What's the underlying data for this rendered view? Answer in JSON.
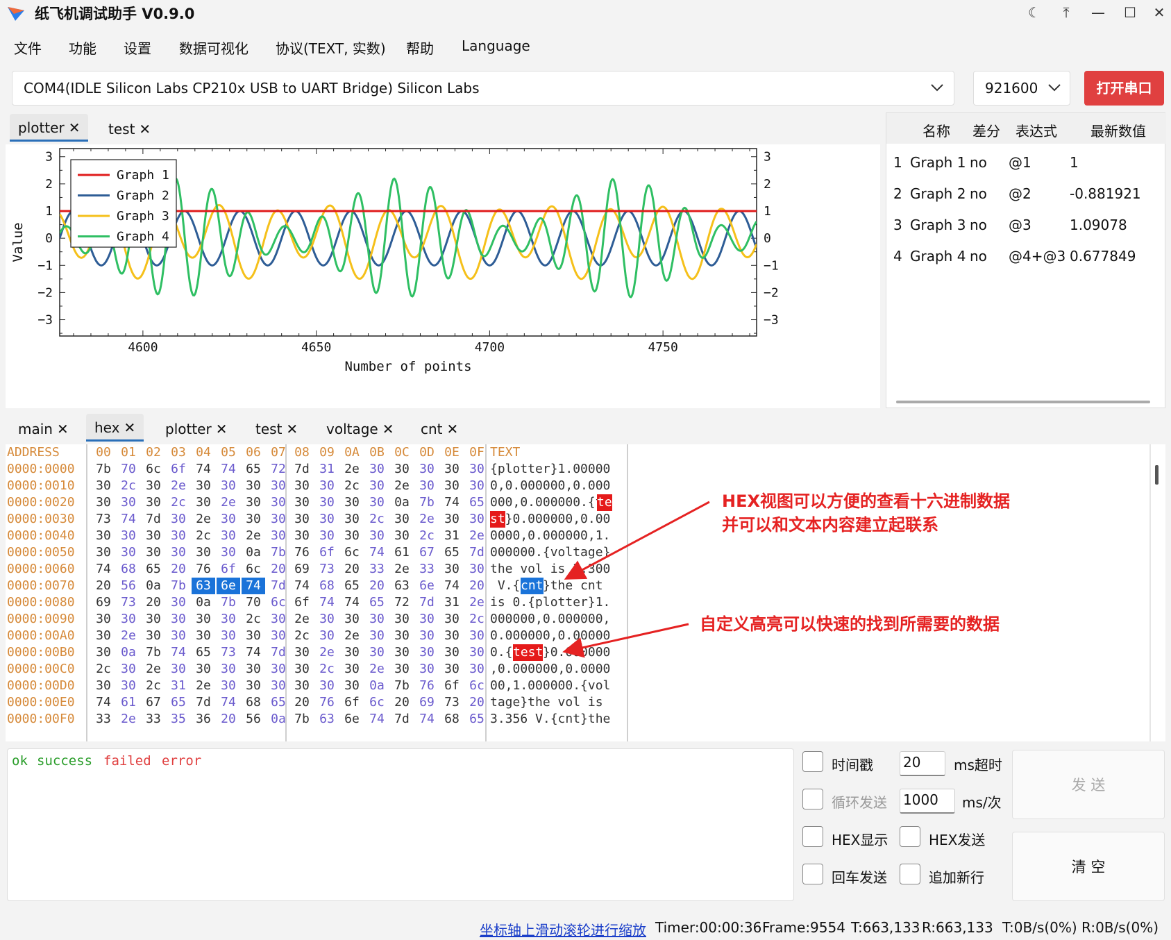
{
  "app": {
    "title": "纸飞机调试助手 V0.9.0"
  },
  "menu": [
    "文件",
    "功能",
    "设置",
    "数据可视化",
    "协议(TEXT, 实数)",
    "帮助",
    "Language"
  ],
  "port": {
    "value": "COM4(IDLE  Silicon Labs CP210x USB to UART Bridge) Silicon Labs",
    "baud": "921600",
    "open_label": "打开串口"
  },
  "plot_tabs": [
    {
      "label": "plotter",
      "active": true
    },
    {
      "label": "test",
      "active": false
    }
  ],
  "chart_data": {
    "type": "line",
    "title": "",
    "xlabel": "Number of points",
    "ylabel": "Value",
    "xlim": [
      4576,
      4777
    ],
    "ylim": [
      -3.6,
      3.3
    ],
    "xticks": [
      4600,
      4650,
      4700,
      4750
    ],
    "yticks": [
      3,
      2,
      1,
      0,
      -1,
      -2,
      -3
    ],
    "legend": "top-left",
    "series": [
      {
        "name": "Graph 1",
        "color": "#e01b1b",
        "values": "constant 1"
      },
      {
        "name": "Graph 2",
        "color": "#2e5d96",
        "values": "sin, amplitude 1, period ~16 points"
      },
      {
        "name": "Graph 3",
        "color": "#f5c01a",
        "values": "amplitude ~1.4"
      },
      {
        "name": "Graph 4",
        "color": "#2fbf63",
        "values": "amplitude ~2.9"
      }
    ]
  },
  "var_table": {
    "headers": [
      "名称",
      "差分",
      "表达式",
      "最新数值"
    ],
    "rows": [
      {
        "idx": "1",
        "name": "Graph 1",
        "diff": "no",
        "expr": "@1",
        "val": "1"
      },
      {
        "idx": "2",
        "name": "Graph 2",
        "diff": "no",
        "expr": "@2",
        "val": "-0.881921"
      },
      {
        "idx": "3",
        "name": "Graph 3",
        "diff": "no",
        "expr": "@3",
        "val": "1.09078"
      },
      {
        "idx": "4",
        "name": "Graph 4",
        "diff": "no",
        "expr": "@4+@3",
        "val": "0.677849"
      }
    ]
  },
  "bottom_tabs": [
    {
      "label": "main",
      "active": false
    },
    {
      "label": "hex",
      "active": true
    },
    {
      "label": "plotter",
      "active": false
    },
    {
      "label": "test",
      "active": false
    },
    {
      "label": "voltage",
      "active": false
    },
    {
      "label": "cnt",
      "active": false
    }
  ],
  "hex": {
    "address_header": "ADDRESS",
    "col_headers": [
      "00",
      "01",
      "02",
      "03",
      "04",
      "05",
      "06",
      "07",
      "08",
      "09",
      "0A",
      "0B",
      "0C",
      "0D",
      "0E",
      "0F"
    ],
    "text_header": "TEXT",
    "rows": [
      {
        "addr": "0000:0000",
        "bytes": [
          "7b",
          "70",
          "6c",
          "6f",
          "74",
          "74",
          "65",
          "72",
          "7d",
          "31",
          "2e",
          "30",
          "30",
          "30",
          "30",
          "30"
        ],
        "text": "{plotter}1.00000"
      },
      {
        "addr": "0000:0010",
        "bytes": [
          "30",
          "2c",
          "30",
          "2e",
          "30",
          "30",
          "30",
          "30",
          "30",
          "30",
          "2c",
          "30",
          "2e",
          "30",
          "30",
          "30"
        ],
        "text": "0,0.000000,0.000"
      },
      {
        "addr": "0000:0020",
        "bytes": [
          "30",
          "30",
          "30",
          "2c",
          "30",
          "2e",
          "30",
          "30",
          "30",
          "30",
          "30",
          "30",
          "0a",
          "7b",
          "74",
          "65"
        ],
        "text": "000,0.000000.{te"
      },
      {
        "addr": "0000:0030",
        "bytes": [
          "73",
          "74",
          "7d",
          "30",
          "2e",
          "30",
          "30",
          "30",
          "30",
          "30",
          "30",
          "2c",
          "30",
          "2e",
          "30",
          "30"
        ],
        "text": "st}0.000000,0.00"
      },
      {
        "addr": "0000:0040",
        "bytes": [
          "30",
          "30",
          "30",
          "30",
          "2c",
          "30",
          "2e",
          "30",
          "30",
          "30",
          "30",
          "30",
          "30",
          "2c",
          "31",
          "2e"
        ],
        "text": "0000,0.000000,1."
      },
      {
        "addr": "0000:0050",
        "bytes": [
          "30",
          "30",
          "30",
          "30",
          "30",
          "30",
          "0a",
          "7b",
          "76",
          "6f",
          "6c",
          "74",
          "61",
          "67",
          "65",
          "7d"
        ],
        "text": "000000.{voltage}"
      },
      {
        "addr": "0000:0060",
        "bytes": [
          "74",
          "68",
          "65",
          "20",
          "76",
          "6f",
          "6c",
          "20",
          "69",
          "73",
          "20",
          "33",
          "2e",
          "33",
          "30",
          "30"
        ],
        "text": "the vol is 3.300"
      },
      {
        "addr": "0000:0070",
        "bytes": [
          "20",
          "56",
          "0a",
          "7b",
          "63",
          "6e",
          "74",
          "7d",
          "74",
          "68",
          "65",
          "20",
          "63",
          "6e",
          "74",
          "20"
        ],
        "text": " V.{cnt}the cnt "
      },
      {
        "addr": "0000:0080",
        "bytes": [
          "69",
          "73",
          "20",
          "30",
          "0a",
          "7b",
          "70",
          "6c",
          "6f",
          "74",
          "74",
          "65",
          "72",
          "7d",
          "31",
          "2e"
        ],
        "text": "is 0.{plotter}1."
      },
      {
        "addr": "0000:0090",
        "bytes": [
          "30",
          "30",
          "30",
          "30",
          "30",
          "30",
          "2c",
          "30",
          "2e",
          "30",
          "30",
          "30",
          "30",
          "30",
          "30",
          "2c"
        ],
        "text": "000000,0.000000,"
      },
      {
        "addr": "0000:00A0",
        "bytes": [
          "30",
          "2e",
          "30",
          "30",
          "30",
          "30",
          "30",
          "30",
          "2c",
          "30",
          "2e",
          "30",
          "30",
          "30",
          "30",
          "30"
        ],
        "text": "0.000000,0.00000"
      },
      {
        "addr": "0000:00B0",
        "bytes": [
          "30",
          "0a",
          "7b",
          "74",
          "65",
          "73",
          "74",
          "7d",
          "30",
          "2e",
          "30",
          "30",
          "30",
          "30",
          "30",
          "30"
        ],
        "text": "0.{test}0.000000"
      },
      {
        "addr": "0000:00C0",
        "bytes": [
          "2c",
          "30",
          "2e",
          "30",
          "30",
          "30",
          "30",
          "30",
          "30",
          "2c",
          "30",
          "2e",
          "30",
          "30",
          "30",
          "30"
        ],
        "text": ",0.000000,0.0000"
      },
      {
        "addr": "0000:00D0",
        "bytes": [
          "30",
          "30",
          "2c",
          "31",
          "2e",
          "30",
          "30",
          "30",
          "30",
          "30",
          "30",
          "0a",
          "7b",
          "76",
          "6f",
          "6c"
        ],
        "text": "00,1.000000.{vol"
      },
      {
        "addr": "0000:00E0",
        "bytes": [
          "74",
          "61",
          "67",
          "65",
          "7d",
          "74",
          "68",
          "65",
          "20",
          "76",
          "6f",
          "6c",
          "20",
          "69",
          "73",
          "20"
        ],
        "text": "tage}the vol is "
      },
      {
        "addr": "0000:00F0",
        "bytes": [
          "33",
          "2e",
          "33",
          "35",
          "36",
          "20",
          "56",
          "0a",
          "7b",
          "63",
          "6e",
          "74",
          "7d",
          "74",
          "68",
          "65"
        ],
        "text": "3.356 V.{cnt}the"
      }
    ]
  },
  "annotations": {
    "hex_line1": "HEX视图可以方便的查看十六进制数据",
    "hex_line2": "并可以和文本内容建立起联系",
    "highlight": "自定义高亮可以快速的找到所需要的数据"
  },
  "console": {
    "ok": "ok",
    "success": "success",
    "failed": "failed",
    "error": "error"
  },
  "send_panel": {
    "timestamp_label": "时间戳",
    "timeout_value": "20",
    "timeout_unit": "ms超时",
    "loop_label": "循环发送",
    "loop_value": "1000",
    "loop_unit": "ms/次",
    "hex_show": "HEX显示",
    "hex_send": "HEX发送",
    "cr_send": "回车发送",
    "newline": "追加新行",
    "send_btn": "发 送",
    "clear_btn": "清 空"
  },
  "status": {
    "hint": "坐标轴上滑动滚轮进行缩放",
    "timer": "Timer:00:00:36",
    "frame": "Frame:9554",
    "t": "T:663,133",
    "r": "R:663,133",
    "rates": "T:0B/s(0%) R:0B/s(0%)"
  }
}
